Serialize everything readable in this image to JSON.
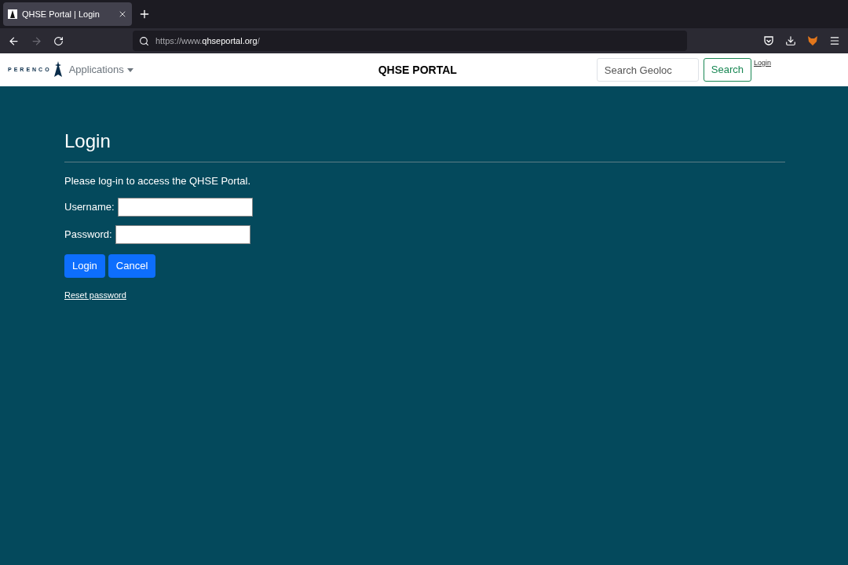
{
  "browser": {
    "tab": {
      "title": "QHSE Portal | Login",
      "selected": true
    },
    "address": {
      "prefix": "https://www.",
      "domain": "qhseportal.org",
      "suffix": "/"
    }
  },
  "navbar": {
    "logo_text": "PERENCO",
    "menu": "Applications",
    "title": "QHSE PORTAL",
    "search": {
      "placeholder": "Search Geoloc"
    },
    "search_button": "Search",
    "login_link": "Login"
  },
  "login": {
    "heading": "Login",
    "intro": "Please log-in to access the QHSE Portal.",
    "fields": [
      {
        "label": "Username:"
      },
      {
        "label": "Password:"
      }
    ],
    "buttons": [
      "Login",
      "Cancel"
    ],
    "reset_link": "Reset password"
  }
}
